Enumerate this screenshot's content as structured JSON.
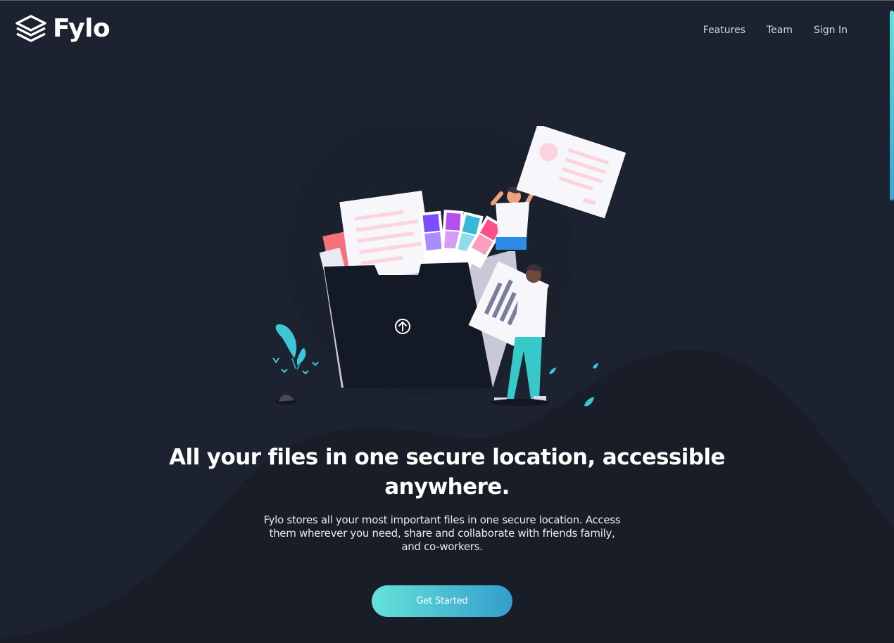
{
  "brand": {
    "name": "Fylo",
    "logo_icon": "stacked-layers-icon"
  },
  "nav": {
    "items": [
      {
        "label": "Features"
      },
      {
        "label": "Team"
      },
      {
        "label": "Sign In"
      }
    ]
  },
  "hero": {
    "title": "All your files in one secure location, accessible anywhere.",
    "description": "Fylo stores all your most important files in one secure location. Access them wherever you need, share and collaborate with friends family, and co-workers.",
    "cta_label": "Get Started",
    "illustration_icon": "upload-arrow-icon"
  },
  "colors": {
    "background": "#1c2230",
    "curve": "#181d28",
    "accent_start": "#65e2d9",
    "accent_end": "#339ecc",
    "text": "#ffffff"
  }
}
